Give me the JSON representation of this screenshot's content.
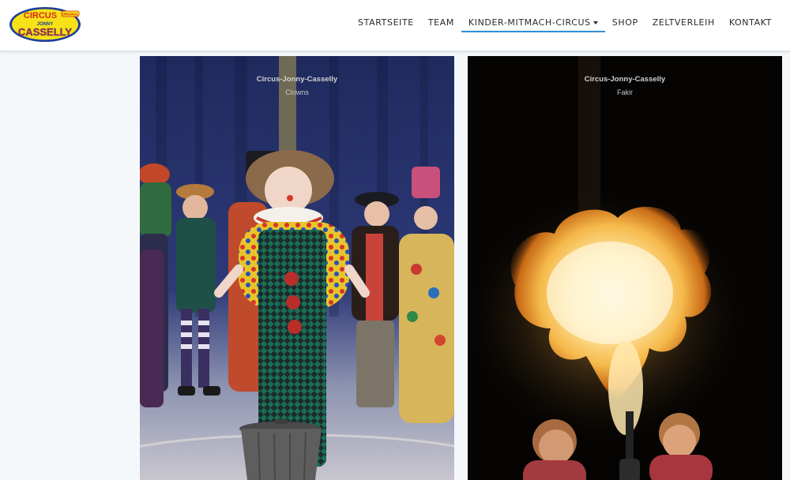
{
  "header": {
    "logo": {
      "word_top": "CIRCUS",
      "word_middle": "JONNY",
      "word_bottom": "CASSELLY",
      "badge": "ORIGINAL",
      "colors": {
        "fill": "#f6e216",
        "outline": "#1d3f9a",
        "text": "#d62a1d"
      }
    },
    "nav": [
      {
        "label": "STARTSEITE"
      },
      {
        "label": "TEAM"
      },
      {
        "label": "KINDER-MITMACH-CIRCUS",
        "active": true,
        "has_dropdown": true
      },
      {
        "label": "SHOP"
      },
      {
        "label": "ZELTVERLEIH"
      },
      {
        "label": "KONTAKT"
      }
    ],
    "accent": "#2f8fd5"
  },
  "gallery": [
    {
      "title": "Circus-Jonny-Casselly",
      "subtitle": "Clowns"
    },
    {
      "title": "Circus-Jonny-Casselly",
      "subtitle": "Fakir"
    }
  ]
}
